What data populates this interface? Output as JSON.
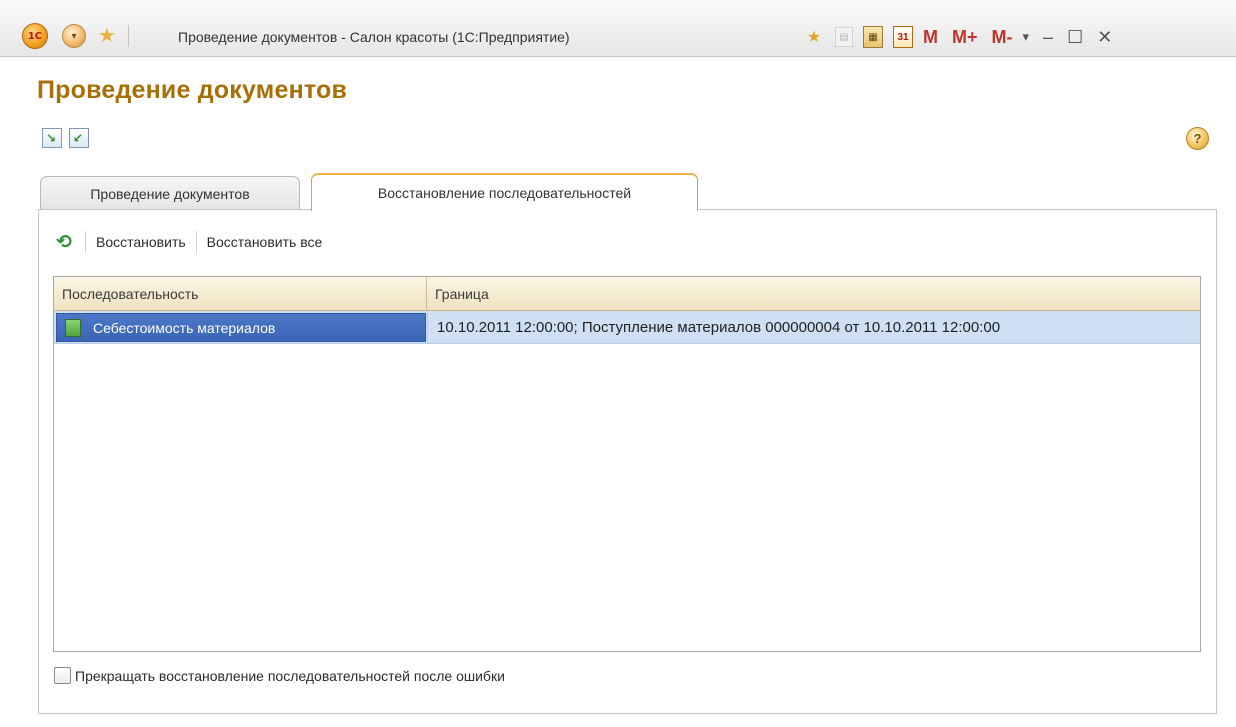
{
  "window": {
    "title": "Проведение документов - Салон красоты  (1С:Предприятие)",
    "logo_text": "1С",
    "memory_buttons": [
      "M",
      "M+",
      "M-"
    ],
    "calendar_day": "31"
  },
  "form": {
    "heading": "Проведение документов",
    "help_label": "?"
  },
  "tabs": [
    {
      "label": "Проведение документов",
      "active": false
    },
    {
      "label": "Восстановление последовательностей",
      "active": true
    }
  ],
  "toolbar": {
    "restore_label": "Восстановить",
    "restore_all_label": "Восстановить все"
  },
  "table": {
    "columns": [
      "Последовательность",
      "Граница"
    ],
    "rows": [
      {
        "sequence": "Себестоимость материалов",
        "boundary": "10.10.2011 12:00:00; Поступление материалов 000000004 от 10.10.2011 12:00:00",
        "selected": true
      }
    ]
  },
  "options": {
    "stop_on_error_label": "Прекращать восстановление последовательностей после ошибки",
    "stop_on_error_checked": false
  },
  "colors": {
    "heading": "#a86f06",
    "selection": "#3a65b5",
    "row_highlight": "#cfe0f5",
    "active_tab_border": "#f0b24a"
  }
}
